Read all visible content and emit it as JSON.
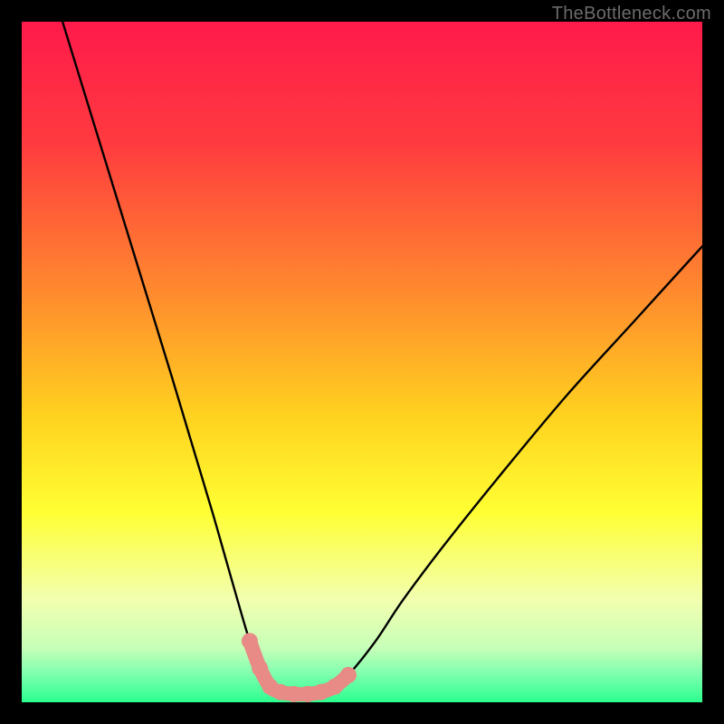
{
  "watermark": "TheBottleneck.com",
  "chart_data": {
    "type": "line",
    "title": "",
    "xlabel": "",
    "ylabel": "",
    "xlim": [
      0,
      100
    ],
    "ylim": [
      0,
      100
    ],
    "gradient_stops": [
      {
        "offset": 0.0,
        "color": "#ff1a4b"
      },
      {
        "offset": 0.18,
        "color": "#ff3b3f"
      },
      {
        "offset": 0.4,
        "color": "#ff8b2e"
      },
      {
        "offset": 0.58,
        "color": "#ffd21f"
      },
      {
        "offset": 0.72,
        "color": "#ffff33"
      },
      {
        "offset": 0.85,
        "color": "#f2ffb0"
      },
      {
        "offset": 0.92,
        "color": "#c7ffb8"
      },
      {
        "offset": 0.96,
        "color": "#7bffae"
      },
      {
        "offset": 1.0,
        "color": "#2bff8e"
      }
    ],
    "curve": {
      "comment": "Main black V-shaped bottleneck curve; y is percentage (100=top, 0=bottom). Values estimated from pixel positions.",
      "x": [
        6,
        10,
        14,
        18,
        22,
        25,
        28,
        30,
        32,
        33.5,
        35,
        36.5,
        38,
        40,
        42,
        44,
        46,
        48,
        52,
        56,
        62,
        70,
        80,
        90,
        100
      ],
      "y": [
        100,
        87,
        74,
        61,
        48,
        38,
        28,
        21,
        14,
        9,
        5,
        2.3,
        1.5,
        1.2,
        1.2,
        1.5,
        2.3,
        4,
        9,
        15,
        23,
        33,
        45,
        56,
        67
      ]
    },
    "flat_marker": {
      "comment": "Thick salmon segment marking the flat bottom / optimal zone",
      "color": "#e88a85",
      "x": [
        33.5,
        35,
        36.5,
        38,
        40,
        42,
        44,
        46,
        48
      ],
      "y": [
        9,
        5,
        2.3,
        1.5,
        1.2,
        1.2,
        1.5,
        2.3,
        4
      ]
    }
  }
}
